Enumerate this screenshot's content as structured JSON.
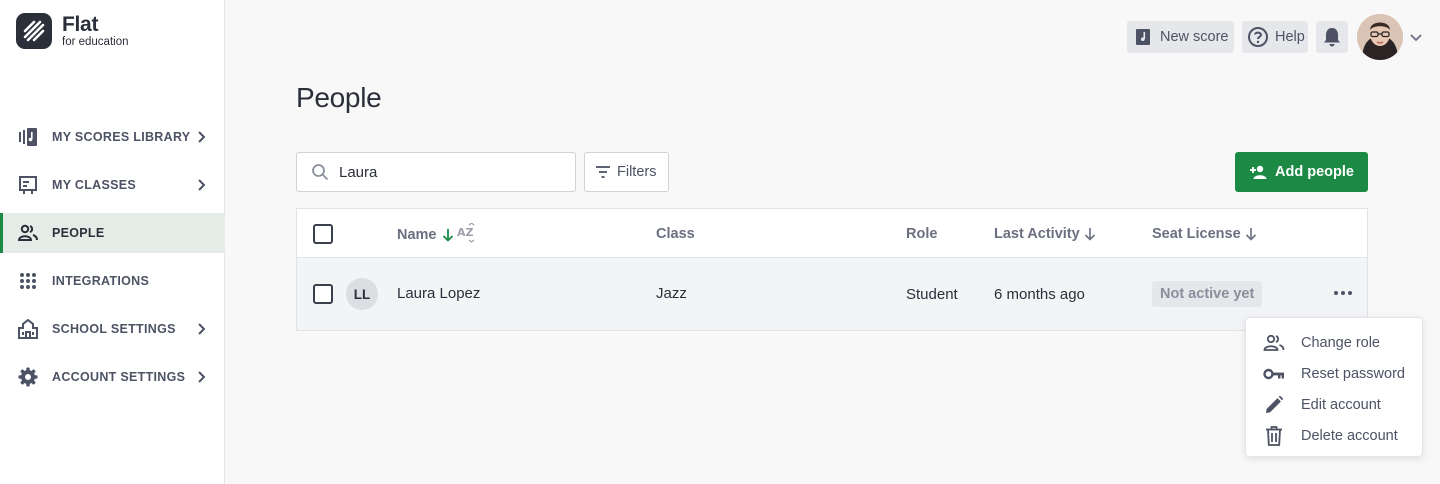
{
  "brand": {
    "title": "Flat",
    "subtitle": "for education",
    "accent_color": "#1c8a45"
  },
  "sidebar": {
    "items": [
      {
        "label": "MY SCORES LIBRARY",
        "icon": "library-icon",
        "has_chevron": true,
        "active": false
      },
      {
        "label": "MY CLASSES",
        "icon": "classes-icon",
        "has_chevron": true,
        "active": false
      },
      {
        "label": "PEOPLE",
        "icon": "people-icon",
        "has_chevron": false,
        "active": true
      },
      {
        "label": "INTEGRATIONS",
        "icon": "grid-icon",
        "has_chevron": false,
        "active": false
      },
      {
        "label": "SCHOOL SETTINGS",
        "icon": "school-icon",
        "has_chevron": true,
        "active": false
      },
      {
        "label": "ACCOUNT SETTINGS",
        "icon": "gear-icon",
        "has_chevron": true,
        "active": false
      }
    ]
  },
  "topbar": {
    "new_score_label": "New score",
    "help_label": "Help"
  },
  "page": {
    "title": "People"
  },
  "search": {
    "value": "Laura",
    "placeholder": "Search"
  },
  "toolbar": {
    "filters_label": "Filters",
    "add_people_label": "Add people"
  },
  "table": {
    "columns": {
      "name": "Name",
      "class": "Class",
      "role": "Role",
      "last_activity": "Last Activity",
      "seat_license": "Seat License"
    },
    "rows": [
      {
        "initials": "LL",
        "name": "Laura Lopez",
        "class": "Jazz",
        "role": "Student",
        "last_activity": "6 months ago",
        "seat_license": "Not active yet"
      }
    ]
  },
  "row_menu": {
    "items": [
      {
        "label": "Change role",
        "icon": "people-icon"
      },
      {
        "label": "Reset password",
        "icon": "key-icon"
      },
      {
        "label": "Edit account",
        "icon": "pencil-icon"
      },
      {
        "label": "Delete account",
        "icon": "trash-icon"
      }
    ]
  }
}
